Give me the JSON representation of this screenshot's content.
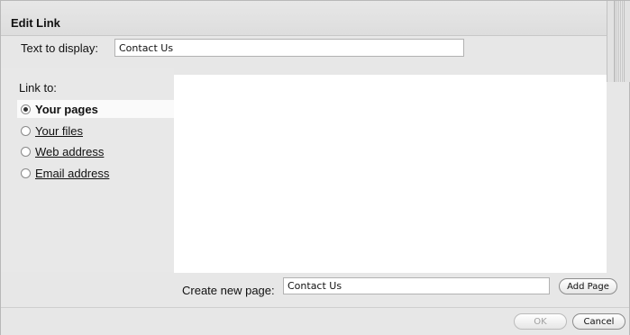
{
  "dialog": {
    "title": "Edit Link"
  },
  "text_to_display": {
    "label": "Text to display:",
    "value": "Contact Us"
  },
  "link_to": {
    "label": "Link to:",
    "options": [
      {
        "label": "Your pages",
        "selected": true
      },
      {
        "label": "Your files",
        "selected": false
      },
      {
        "label": "Web address",
        "selected": false
      },
      {
        "label": "Email address",
        "selected": false
      }
    ]
  },
  "create_page": {
    "label": "Create new page:",
    "value": "Contact Us",
    "button_label": "Add Page"
  },
  "footer": {
    "ok_label": "OK",
    "cancel_label": "Cancel"
  }
}
